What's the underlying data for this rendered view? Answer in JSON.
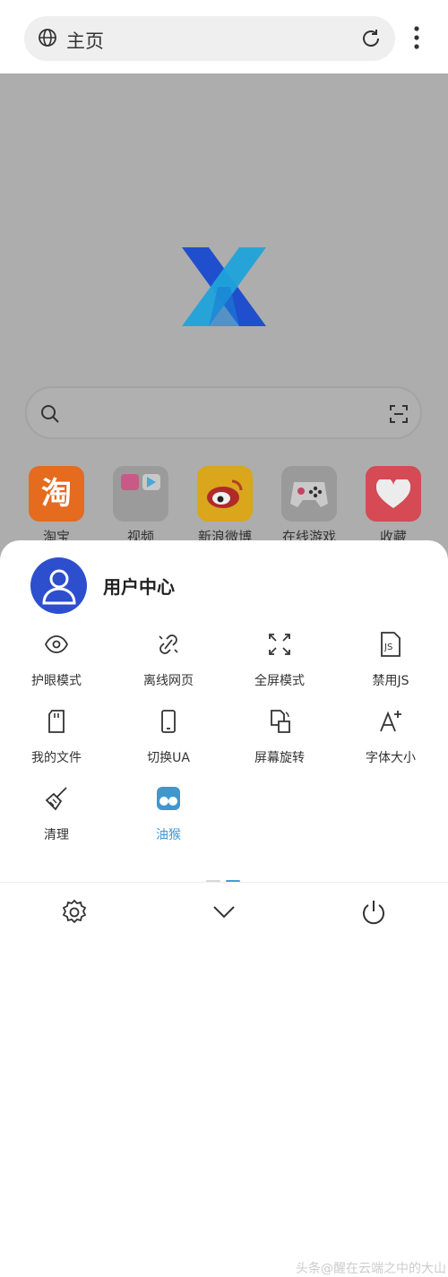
{
  "address_bar": {
    "title": "主页"
  },
  "search": {},
  "shortcuts": [
    {
      "label": "淘宝",
      "glyph": "淘",
      "color": "#e56b1f"
    },
    {
      "label": "视频",
      "color": "#9b9b9b"
    },
    {
      "label": "新浪微博",
      "color": "#d9a61c"
    },
    {
      "label": "在线游戏",
      "color": "#9a9a9a"
    },
    {
      "label": "收藏",
      "color": "#d54a55"
    }
  ],
  "menu": {
    "user_center": "用户中心",
    "items": [
      {
        "label": "护眼模式",
        "icon": "eye-icon"
      },
      {
        "label": "离线网页",
        "icon": "link-broken-icon"
      },
      {
        "label": "全屏模式",
        "icon": "fullscreen-icon"
      },
      {
        "label": "禁用JS",
        "icon": "js-file-icon"
      },
      {
        "label": "我的文件",
        "icon": "sd-card-icon"
      },
      {
        "label": "切换UA",
        "icon": "phone-icon"
      },
      {
        "label": "屏幕旋转",
        "icon": "rotate-screen-icon"
      },
      {
        "label": "字体大小",
        "icon": "font-size-icon"
      },
      {
        "label": "清理",
        "icon": "broom-icon"
      },
      {
        "label": "油猴",
        "icon": "tampermonkey-icon",
        "active": true
      }
    ],
    "page_indicator": {
      "pages": 2,
      "current": 2
    }
  },
  "watermark": "头条@醒在云端之中的大山",
  "colors": {
    "accent": "#3f97cf",
    "avatar": "#2d4fce",
    "logo_dark": "#1f4fcc",
    "logo_light": "#20a3d9"
  }
}
